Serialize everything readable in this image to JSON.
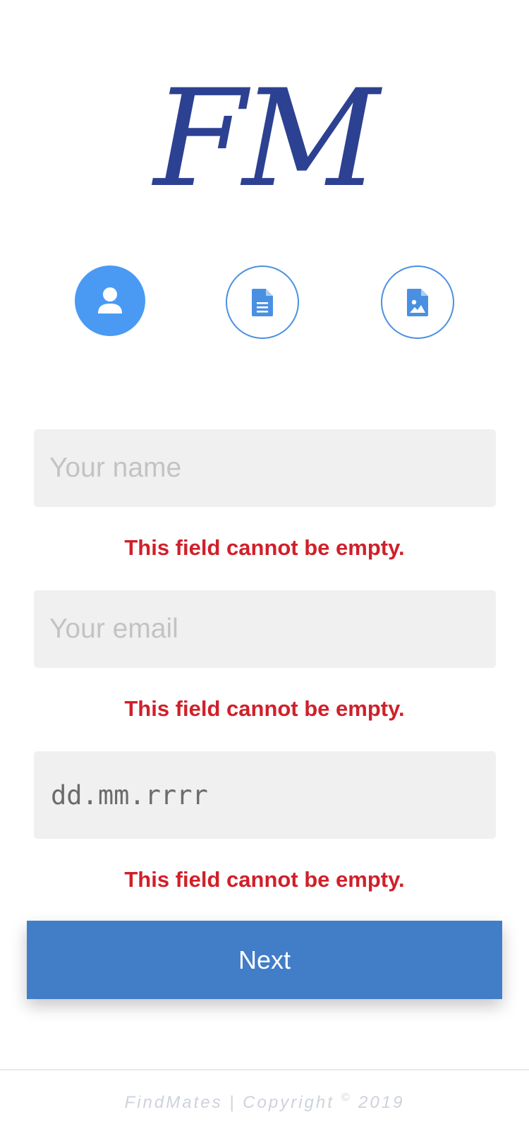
{
  "logo": {
    "text": "FM"
  },
  "steps": [
    {
      "name": "profile",
      "icon": "user-icon",
      "active": true
    },
    {
      "name": "document",
      "icon": "document-icon",
      "active": false
    },
    {
      "name": "photo",
      "icon": "image-file-icon",
      "active": false
    }
  ],
  "form": {
    "name": {
      "placeholder": "Your name",
      "value": ""
    },
    "email": {
      "placeholder": "Your email",
      "value": ""
    },
    "date": {
      "text": "dd.mm.rrrr"
    },
    "error_message": "This field cannot be empty."
  },
  "next_button": {
    "label": "Next"
  },
  "footer": {
    "brand": "FindMates | Copyright",
    "symbol": "©",
    "year": "2019"
  },
  "colors": {
    "brand": "#2d4192",
    "accent": "#4a9af4",
    "button": "#427dc8",
    "error": "#d0202a",
    "field_bg": "#f0f0f0"
  }
}
